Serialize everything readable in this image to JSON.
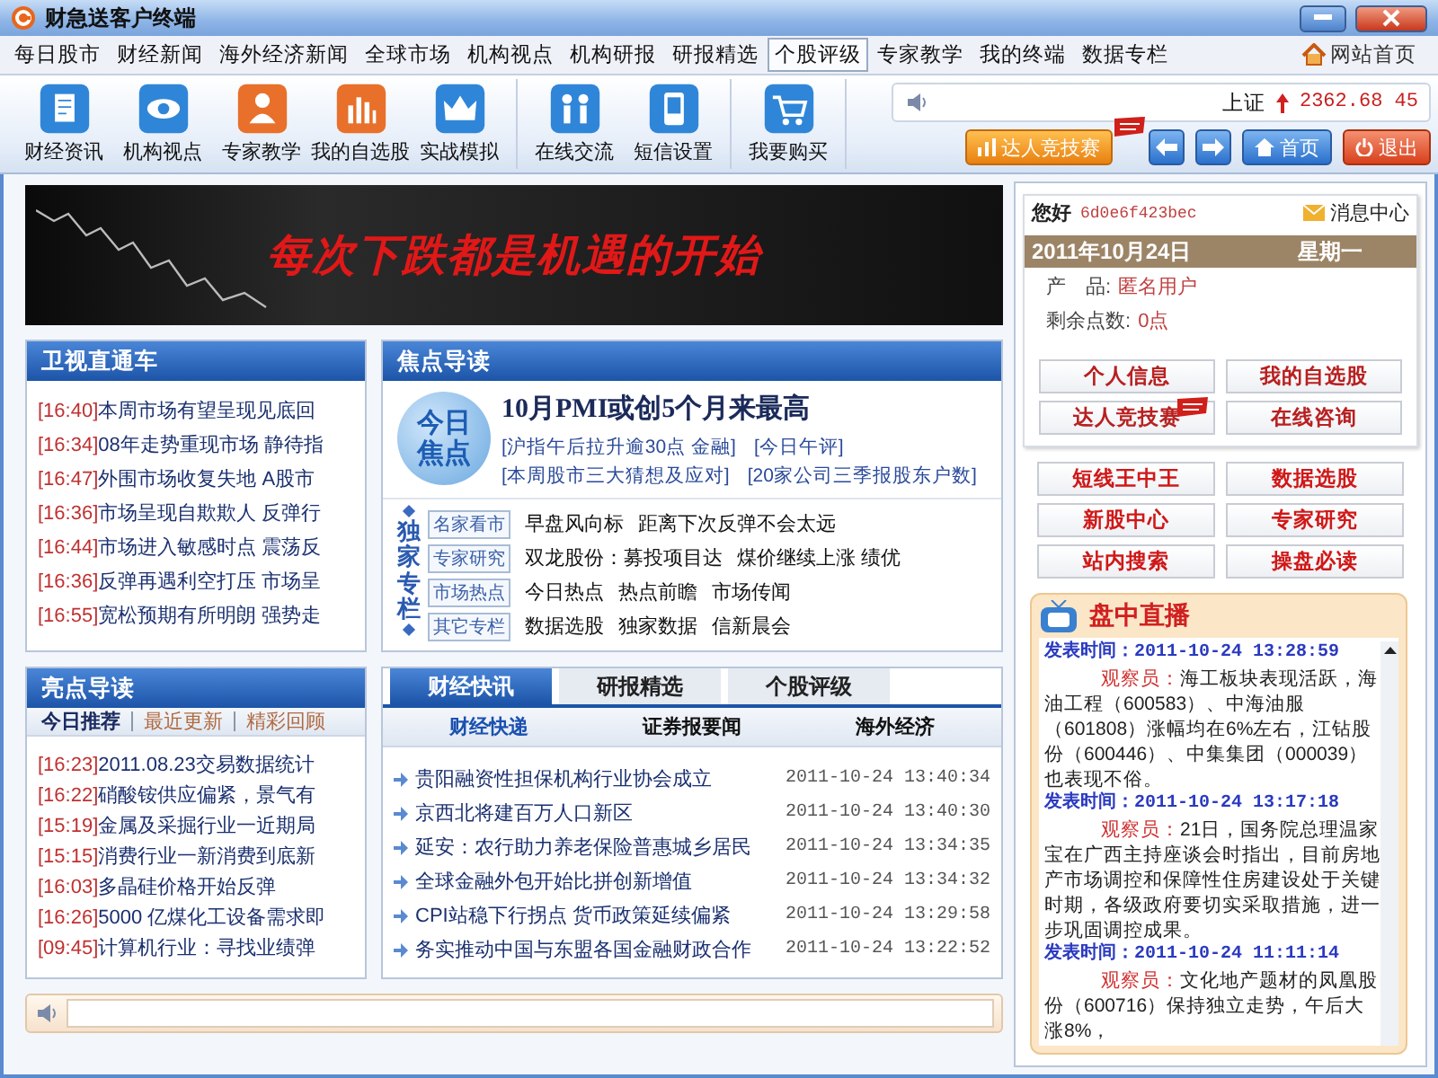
{
  "window": {
    "title": "财急送客户终端"
  },
  "menu": [
    {
      "label": "每日股市",
      "selected": false
    },
    {
      "label": "财经新闻",
      "selected": false
    },
    {
      "label": "海外经济新闻",
      "selected": false
    },
    {
      "label": "全球市场",
      "selected": false
    },
    {
      "label": "机构视点",
      "selected": false
    },
    {
      "label": "机构研报",
      "selected": false
    },
    {
      "label": "研报精选",
      "selected": false
    },
    {
      "label": "个股评级",
      "selected": true
    },
    {
      "label": "专家教学",
      "selected": false
    },
    {
      "label": "我的终端",
      "selected": false
    },
    {
      "label": "数据专栏",
      "selected": false
    }
  ],
  "site_link": "网站首页",
  "toolbar": [
    [
      "财经资讯",
      "机构视点",
      "专家教学",
      "我的自选股",
      "实战模拟"
    ],
    [
      "在线交流",
      "短信设置"
    ],
    [
      "我要购买"
    ]
  ],
  "ticker": {
    "label": "上证",
    "rising": true,
    "value": "2362.68 45"
  },
  "top_buttons": [
    {
      "kind": "contest",
      "label": "达人竞技赛",
      "new": true
    },
    {
      "kind": "back"
    },
    {
      "kind": "forward"
    },
    {
      "kind": "home",
      "label": "首页"
    },
    {
      "kind": "exit",
      "label": "退出"
    }
  ],
  "banner": {
    "slogan": "每次下跌都是机遇的开始"
  },
  "tv_panel": {
    "title": "卫视直通车",
    "items": [
      {
        "time": "[16:40]",
        "text": "本周市场有望呈现见底回"
      },
      {
        "time": "[16:34]",
        "text": "08年走势重现市场 静待指"
      },
      {
        "time": "[16:47]",
        "text": "外围市场收复失地 A股市"
      },
      {
        "time": "[16:36]",
        "text": "市场呈现自欺欺人 反弹行"
      },
      {
        "time": "[16:44]",
        "text": "市场进入敏感时点 震荡反"
      },
      {
        "time": "[16:36]",
        "text": "反弹再遇利空打压 市场呈"
      },
      {
        "time": "[16:55]",
        "text": "宽松预期有所明朗 强势走"
      }
    ]
  },
  "focus": {
    "title": "焦点导读",
    "logo": "今日焦点",
    "headline": "10月PMI或创5个月来最高",
    "links": [
      [
        "[沪指午后拉升逾30点 金融]",
        "[今日午评]"
      ],
      [
        "[本周股市三大猜想及应对]",
        "[20家公司三季报股东户数]"
      ]
    ],
    "column_label": "独家专栏",
    "columns": [
      {
        "name": "名家看市",
        "links": [
          "早盘风向标",
          "距离下次反弹不会太远"
        ]
      },
      {
        "name": "专家研究",
        "links": [
          "双龙股份：募投项目达",
          "煤价继续上涨 绩优"
        ]
      },
      {
        "name": "市场热点",
        "links": [
          "今日热点",
          "热点前瞻",
          "市场传闻"
        ]
      },
      {
        "name": "其它专栏",
        "links": [
          "数据选股",
          "独家数据",
          "信新晨会"
        ]
      }
    ]
  },
  "highlights": {
    "title": "亮点导读",
    "tabs": [
      {
        "label": "今日推荐",
        "selected": true
      },
      {
        "label": "最近更新",
        "selected": false
      },
      {
        "label": "精彩回顾",
        "selected": false
      }
    ],
    "items": [
      {
        "time": "[16:23]",
        "text": "2011.08.23交易数据统计"
      },
      {
        "time": "[16:22]",
        "text": "硝酸铵供应偏紧，景气有"
      },
      {
        "time": "[15:19]",
        "text": "金属及采掘行业一近期局"
      },
      {
        "time": "[15:15]",
        "text": "消费行业一新消费到底新"
      },
      {
        "time": "[16:03]",
        "text": "多晶硅价格开始反弹"
      },
      {
        "time": "[16:26]",
        "text": "5000 亿煤化工设备需求即"
      },
      {
        "time": "[09:45]",
        "text": "计算机行业：寻找业绩弹"
      }
    ]
  },
  "news": {
    "tabs": [
      {
        "label": "财经快讯",
        "selected": true
      },
      {
        "label": "研报精选",
        "selected": false
      },
      {
        "label": "个股评级",
        "selected": false
      }
    ],
    "subtabs": [
      {
        "label": "财经快递",
        "selected": true
      },
      {
        "label": "证券报要闻",
        "selected": false
      },
      {
        "label": "海外经济",
        "selected": false
      }
    ],
    "items": [
      {
        "title": "贵阳融资性担保机构行业协会成立",
        "time": "2011-10-24 13:40:34"
      },
      {
        "title": "京西北将建百万人口新区",
        "time": "2011-10-24 13:40:30"
      },
      {
        "title": "延安：农行助力养老保险普惠城乡居民",
        "time": "2011-10-24 13:34:35"
      },
      {
        "title": "全球金融外包开始比拼创新增值",
        "time": "2011-10-24 13:34:32"
      },
      {
        "title": "CPI站稳下行拐点 货币政策延续偏紧",
        "time": "2011-10-24 13:29:58"
      },
      {
        "title": "务实推动中国与东盟各国金融财政合作",
        "time": "2011-10-24 13:22:52"
      }
    ]
  },
  "user": {
    "greeting": "您好",
    "user_id": "6d0e6f423bec",
    "messages": "消息中心",
    "date": "2011年10月24日",
    "weekday": "星期一",
    "fields": [
      {
        "label": "产　品:",
        "value": "匿名用户"
      },
      {
        "label": "剩余点数:",
        "value": "0点"
      }
    ]
  },
  "user_buttons": [
    {
      "label": "个人信息",
      "new": false
    },
    {
      "label": "我的自选股",
      "new": false
    },
    {
      "label": "达人竞技赛",
      "new": true
    },
    {
      "label": "在线咨询",
      "new": false
    }
  ],
  "feature_buttons": [
    "短线王中王",
    "数据选股",
    "新股中心",
    "专家研究",
    "站内搜索",
    "操盘必读"
  ],
  "live": {
    "title": "盘中直播",
    "entries": [
      {
        "time": "发表时间：2011-10-24 13:28:59",
        "author": "观察员：",
        "text": "海工板块表现活跃，海油工程（600583）、中海油服（601808）涨幅均在6%左右，江钻股份（600446）、中集集团（000039）也表现不俗。"
      },
      {
        "time": "发表时间：2011-10-24 13:17:18",
        "author": "观察员：",
        "text": "21日，国务院总理温家宝在广西主持座谈会时指出，目前房地产市场调控和保障性住房建设处于关键时期，各级政府要切实采取措施，进一步巩固调控成果。"
      },
      {
        "time": "发表时间：2011-10-24 11:11:14",
        "author": "观察员：",
        "text": "文化地产题材的凤凰股份（600716）保持独立走势，午后大涨8%，"
      }
    ]
  }
}
